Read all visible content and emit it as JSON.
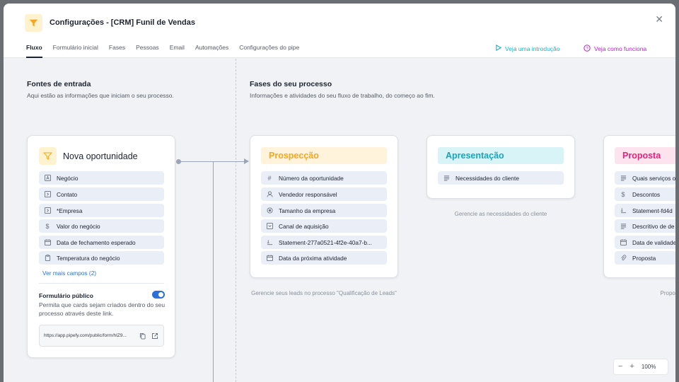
{
  "header": {
    "title": "Configurações - [CRM] Funil de Vendas",
    "close_icon": "close-icon",
    "app_icon": "funnel-icon",
    "brand_color": "#f5a623"
  },
  "tabs": [
    {
      "label": "Fluxo",
      "active": true
    },
    {
      "label": "Formulário inicial"
    },
    {
      "label": "Fases"
    },
    {
      "label": "Pessoas"
    },
    {
      "label": "Email"
    },
    {
      "label": "Automações"
    },
    {
      "label": "Configurações do pipe"
    }
  ],
  "help": {
    "intro_label": "Veja uma introdução",
    "how_label": "Veja como funciona"
  },
  "sources": {
    "title": "Fontes de entrada",
    "subtitle": "Aqui estão as informações que iniciam o seu processo.",
    "card": {
      "title": "Nova oportunidade",
      "fields": [
        {
          "label": "Negócio",
          "icon": "text-icon"
        },
        {
          "label": "Contato",
          "icon": "connection-icon"
        },
        {
          "label": "*Empresa",
          "icon": "connection-icon"
        },
        {
          "label": "Valor do negócio",
          "icon": "dollar-icon"
        },
        {
          "label": "Data de fechamento esperado",
          "icon": "calendar-icon"
        },
        {
          "label": "Temperatura do negócio",
          "icon": "clipboard-icon"
        }
      ],
      "more_label": "Ver mais campos (2)",
      "public_form": {
        "title": "Formulário público",
        "enabled": true,
        "description": "Permita que cards sejam criados dentro do seu processo através deste link.",
        "url": "https://app.pipefy.com/public/form/hIZ9..."
      }
    }
  },
  "phases": {
    "title": "Fases do seu processo",
    "subtitle": "Informações e atividades do seu fluxo de trabalho, do começo ao fim.",
    "items": [
      {
        "name": "Prospecção",
        "color": "#f5a623",
        "bg": "#fff3dc",
        "fields": [
          {
            "label": "Número da oportunidade",
            "icon": "hash-icon"
          },
          {
            "label": "Vendedor responsável",
            "icon": "user-icon"
          },
          {
            "label": "Tamanho da empresa",
            "icon": "radio-icon"
          },
          {
            "label": "Canal de aquisição",
            "icon": "dropdown-icon"
          },
          {
            "label": "Statement-277a0521-4f2e-40a7-b...",
            "icon": "statement-icon"
          },
          {
            "label": "Data da próxima atividade",
            "icon": "calendar-icon"
          }
        ],
        "note": "Gerencie seus leads no processo \"Qualificação de Leads\""
      },
      {
        "name": "Apresentação",
        "color": "#16a5bb",
        "bg": "#d9f4f7",
        "fields": [
          {
            "label": "Necessidades do cliente",
            "icon": "long-text-icon"
          }
        ],
        "note": "Gerencie as necessidades do cliente"
      },
      {
        "name": "Proposta",
        "color": "#e6237a",
        "bg": "#fde3ee",
        "fields": [
          {
            "label": "Quais serviços o",
            "icon": "long-text-icon"
          },
          {
            "label": "Descontos",
            "icon": "dollar-icon"
          },
          {
            "label": "Statement-fd4d",
            "icon": "statement-icon"
          },
          {
            "label": "Descritivo de de",
            "icon": "long-text-icon"
          },
          {
            "label": "Data de validade",
            "icon": "calendar-icon"
          },
          {
            "label": "Proposta",
            "icon": "attachment-icon"
          }
        ],
        "note": "Propostas a s"
      }
    ]
  },
  "zoom": {
    "minus": "−",
    "plus": "+",
    "level": "100%"
  }
}
